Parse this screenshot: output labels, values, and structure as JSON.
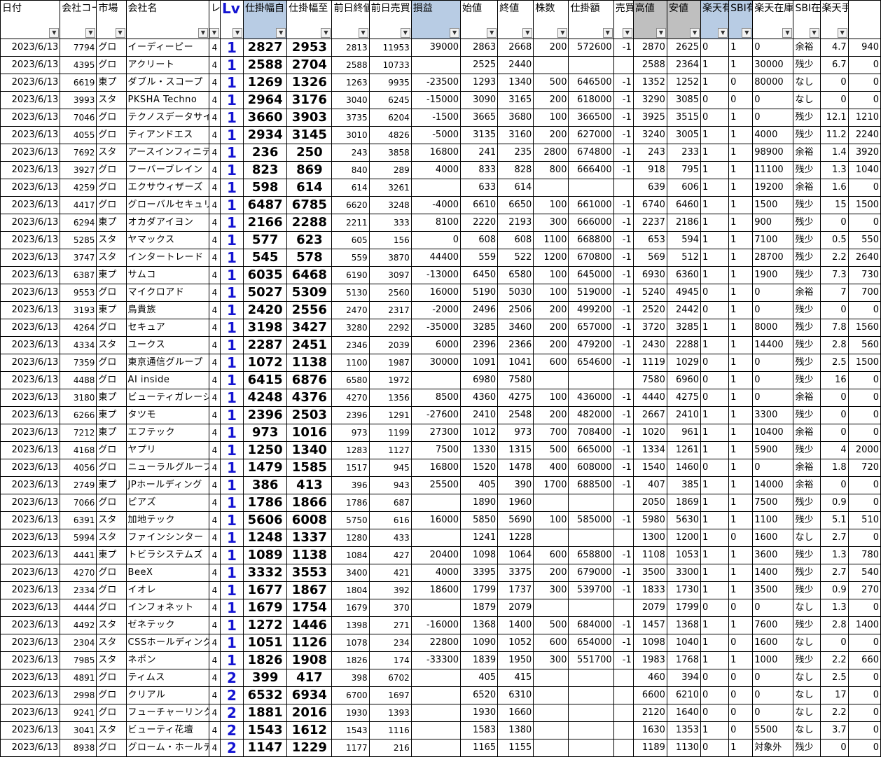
{
  "headers": [
    {
      "label": "日付",
      "style": ""
    },
    {
      "label": "会社コード",
      "style": ""
    },
    {
      "label": "市場",
      "style": ""
    },
    {
      "label": "会社名",
      "style": ""
    },
    {
      "label": "レ",
      "style": ""
    },
    {
      "label": "Lv",
      "style": "lv"
    },
    {
      "label": "仕掛幅自",
      "style": "blue"
    },
    {
      "label": "仕掛幅至",
      "style": ""
    },
    {
      "label": "前日終値",
      "style": ""
    },
    {
      "label": "前日売買(百万円)",
      "style": ""
    },
    {
      "label": "損益",
      "style": "blue"
    },
    {
      "label": "始値",
      "style": ""
    },
    {
      "label": "終値",
      "style": ""
    },
    {
      "label": "株数",
      "style": ""
    },
    {
      "label": "仕掛額",
      "style": ""
    },
    {
      "label": "売買",
      "style": ""
    },
    {
      "label": "高値",
      "style": "gray"
    },
    {
      "label": "安値",
      "style": "gray"
    },
    {
      "label": "楽天有無",
      "style": "blue"
    },
    {
      "label": "SBI有無",
      "style": "blue"
    },
    {
      "label": "楽天在庫数",
      "style": ""
    },
    {
      "label": "SBI在庫数",
      "style": ""
    },
    {
      "label": "楽天手数料",
      "style": ""
    },
    {
      "label": "",
      "style": ""
    }
  ],
  "rows": [
    [
      "2023/6/13",
      "7794",
      "グロ",
      "イーディーピー",
      "4",
      "1",
      "2827",
      "2953",
      "2813",
      "11953",
      "39000",
      "2863",
      "2668",
      "200",
      "572600",
      "-1",
      "2870",
      "2625",
      "0",
      "1",
      "0",
      "余裕",
      "4.7",
      "940"
    ],
    [
      "2023/6/13",
      "4395",
      "グロ",
      "アクリート",
      "4",
      "1",
      "2588",
      "2704",
      "2588",
      "10733",
      "",
      "2525",
      "2440",
      "",
      "",
      "",
      "2588",
      "2364",
      "1",
      "1",
      "30000",
      "残少",
      "6.7",
      "0"
    ],
    [
      "2023/6/13",
      "6619",
      "東プ",
      "ダブル・スコープ",
      "4",
      "1",
      "1269",
      "1326",
      "1263",
      "9935",
      "-23500",
      "1293",
      "1340",
      "500",
      "646500",
      "-1",
      "1352",
      "1252",
      "1",
      "0",
      "80000",
      "なし",
      "0",
      "0"
    ],
    [
      "2023/6/13",
      "3993",
      "スタ",
      "PKSHA Techno",
      "4",
      "1",
      "2964",
      "3176",
      "3040",
      "6245",
      "-15000",
      "3090",
      "3165",
      "200",
      "618000",
      "-1",
      "3290",
      "3085",
      "0",
      "0",
      "0",
      "なし",
      "0",
      "0"
    ],
    [
      "2023/6/13",
      "7046",
      "グロ",
      "テクノスデータサイ",
      "4",
      "1",
      "3660",
      "3903",
      "3735",
      "6204",
      "-1500",
      "3665",
      "3680",
      "100",
      "366500",
      "-1",
      "3925",
      "3515",
      "0",
      "1",
      "0",
      "残少",
      "12.1",
      "1210"
    ],
    [
      "2023/6/13",
      "4055",
      "グロ",
      "ティアンドエス",
      "4",
      "1",
      "2934",
      "3145",
      "3010",
      "4826",
      "-5000",
      "3135",
      "3160",
      "200",
      "627000",
      "-1",
      "3240",
      "3005",
      "1",
      "1",
      "4000",
      "残少",
      "11.2",
      "2240"
    ],
    [
      "2023/6/13",
      "7692",
      "スタ",
      "アースインフィニテ",
      "4",
      "1",
      "236",
      "250",
      "243",
      "3858",
      "16800",
      "241",
      "235",
      "2800",
      "674800",
      "-1",
      "243",
      "233",
      "1",
      "1",
      "98900",
      "余裕",
      "1.4",
      "3920"
    ],
    [
      "2023/6/13",
      "3927",
      "グロ",
      "フーバーブレイン",
      "4",
      "1",
      "823",
      "869",
      "840",
      "289",
      "4000",
      "833",
      "828",
      "800",
      "666400",
      "-1",
      "918",
      "795",
      "1",
      "1",
      "11100",
      "残少",
      "1.3",
      "1040"
    ],
    [
      "2023/6/13",
      "4259",
      "グロ",
      "エクサウィザーズ",
      "4",
      "1",
      "598",
      "614",
      "614",
      "3261",
      "",
      "633",
      "614",
      "",
      "",
      "",
      "639",
      "606",
      "1",
      "1",
      "19200",
      "余裕",
      "1.6",
      "0"
    ],
    [
      "2023/6/13",
      "4417",
      "グロ",
      "グローバルセキュリ",
      "4",
      "1",
      "6487",
      "6785",
      "6620",
      "3248",
      "-4000",
      "6610",
      "6650",
      "100",
      "661000",
      "-1",
      "6740",
      "6460",
      "1",
      "1",
      "1500",
      "残少",
      "15",
      "1500"
    ],
    [
      "2023/6/13",
      "6294",
      "東プ",
      "オカダアイヨン",
      "4",
      "1",
      "2166",
      "2288",
      "2211",
      "333",
      "8100",
      "2220",
      "2193",
      "300",
      "666000",
      "-1",
      "2237",
      "2186",
      "1",
      "1",
      "900",
      "残少",
      "0",
      "0"
    ],
    [
      "2023/6/13",
      "5285",
      "スタ",
      "ヤマックス",
      "4",
      "1",
      "577",
      "623",
      "605",
      "156",
      "0",
      "608",
      "608",
      "1100",
      "668800",
      "-1",
      "653",
      "594",
      "1",
      "1",
      "7100",
      "残少",
      "0.5",
      "550"
    ],
    [
      "2023/6/13",
      "3747",
      "スタ",
      "インタートレード",
      "4",
      "1",
      "545",
      "578",
      "559",
      "3870",
      "44400",
      "559",
      "522",
      "1200",
      "670800",
      "-1",
      "569",
      "512",
      "1",
      "1",
      "28700",
      "残少",
      "2.2",
      "2640"
    ],
    [
      "2023/6/13",
      "6387",
      "東プ",
      "サムコ",
      "4",
      "1",
      "6035",
      "6468",
      "6190",
      "3097",
      "-13000",
      "6450",
      "6580",
      "100",
      "645000",
      "-1",
      "6930",
      "6360",
      "1",
      "1",
      "1900",
      "残少",
      "7.3",
      "730"
    ],
    [
      "2023/6/13",
      "9553",
      "グロ",
      "マイクロアド",
      "4",
      "1",
      "5027",
      "5309",
      "5130",
      "2560",
      "16000",
      "5190",
      "5030",
      "100",
      "519000",
      "-1",
      "5240",
      "4945",
      "0",
      "1",
      "0",
      "余裕",
      "7",
      "700"
    ],
    [
      "2023/6/13",
      "3193",
      "東プ",
      "鳥貴族",
      "4",
      "1",
      "2420",
      "2556",
      "2470",
      "2317",
      "-2000",
      "2496",
      "2506",
      "200",
      "499200",
      "-1",
      "2520",
      "2442",
      "0",
      "1",
      "0",
      "残少",
      "0",
      "0"
    ],
    [
      "2023/6/13",
      "4264",
      "グロ",
      "セキュア",
      "4",
      "1",
      "3198",
      "3427",
      "3280",
      "2292",
      "-35000",
      "3285",
      "3460",
      "200",
      "657000",
      "-1",
      "3720",
      "3285",
      "1",
      "1",
      "8000",
      "残少",
      "7.8",
      "1560"
    ],
    [
      "2023/6/13",
      "4334",
      "スタ",
      "ユークス",
      "4",
      "1",
      "2287",
      "2451",
      "2346",
      "2039",
      "6000",
      "2396",
      "2366",
      "200",
      "479200",
      "-1",
      "2430",
      "2288",
      "1",
      "1",
      "14400",
      "残少",
      "2.8",
      "560"
    ],
    [
      "2023/6/13",
      "7359",
      "グロ",
      "東京通信グループ",
      "4",
      "1",
      "1072",
      "1138",
      "1100",
      "1987",
      "30000",
      "1091",
      "1041",
      "600",
      "654600",
      "-1",
      "1119",
      "1029",
      "0",
      "1",
      "0",
      "残少",
      "2.5",
      "1500"
    ],
    [
      "2023/6/13",
      "4488",
      "グロ",
      "AI inside",
      "4",
      "1",
      "6415",
      "6876",
      "6580",
      "1972",
      "",
      "6980",
      "7580",
      "",
      "",
      "",
      "7580",
      "6960",
      "0",
      "1",
      "0",
      "残少",
      "16",
      "0"
    ],
    [
      "2023/6/13",
      "3180",
      "東プ",
      "ビューティガレージ",
      "4",
      "1",
      "4248",
      "4376",
      "4270",
      "1356",
      "8500",
      "4360",
      "4275",
      "100",
      "436000",
      "-1",
      "4440",
      "4275",
      "0",
      "1",
      "0",
      "余裕",
      "0",
      "0"
    ],
    [
      "2023/6/13",
      "6266",
      "東プ",
      "タツモ",
      "4",
      "1",
      "2396",
      "2503",
      "2396",
      "1291",
      "-27600",
      "2410",
      "2548",
      "200",
      "482000",
      "-1",
      "2667",
      "2410",
      "1",
      "1",
      "3300",
      "残少",
      "0",
      "0"
    ],
    [
      "2023/6/13",
      "7212",
      "東プ",
      "エフテック",
      "4",
      "1",
      "973",
      "1016",
      "973",
      "1199",
      "27300",
      "1012",
      "973",
      "700",
      "708400",
      "-1",
      "1020",
      "961",
      "1",
      "1",
      "10400",
      "余裕",
      "0",
      "0"
    ],
    [
      "2023/6/13",
      "4168",
      "グロ",
      "ヤプリ",
      "4",
      "1",
      "1250",
      "1340",
      "1283",
      "1127",
      "7500",
      "1330",
      "1315",
      "500",
      "665000",
      "-1",
      "1334",
      "1261",
      "1",
      "1",
      "5900",
      "残少",
      "4",
      "2000"
    ],
    [
      "2023/6/13",
      "4056",
      "グロ",
      "ニューラルグループ",
      "4",
      "1",
      "1479",
      "1585",
      "1517",
      "945",
      "16800",
      "1520",
      "1478",
      "400",
      "608000",
      "-1",
      "1540",
      "1460",
      "0",
      "1",
      "0",
      "余裕",
      "1.8",
      "720"
    ],
    [
      "2023/6/13",
      "2749",
      "東プ",
      "JPホールディング",
      "4",
      "1",
      "386",
      "413",
      "396",
      "943",
      "25500",
      "405",
      "390",
      "1700",
      "688500",
      "-1",
      "407",
      "385",
      "1",
      "1",
      "14000",
      "余裕",
      "0",
      "0"
    ],
    [
      "2023/6/13",
      "7066",
      "グロ",
      "ピアズ",
      "4",
      "1",
      "1786",
      "1866",
      "1786",
      "687",
      "",
      "1890",
      "1960",
      "",
      "",
      "",
      "2050",
      "1869",
      "1",
      "1",
      "7500",
      "残少",
      "0.9",
      "0"
    ],
    [
      "2023/6/13",
      "6391",
      "スタ",
      "加地テック",
      "4",
      "1",
      "5606",
      "6008",
      "5750",
      "616",
      "16000",
      "5850",
      "5690",
      "100",
      "585000",
      "-1",
      "5980",
      "5630",
      "1",
      "1",
      "1100",
      "残少",
      "5.1",
      "510"
    ],
    [
      "2023/6/13",
      "5994",
      "スタ",
      "ファインシンター",
      "4",
      "1",
      "1248",
      "1337",
      "1280",
      "433",
      "",
      "1241",
      "1228",
      "",
      "",
      "",
      "1300",
      "1200",
      "1",
      "0",
      "1600",
      "なし",
      "2.7",
      "0"
    ],
    [
      "2023/6/13",
      "4441",
      "東プ",
      "トビラシステムズ",
      "4",
      "1",
      "1089",
      "1138",
      "1084",
      "427",
      "20400",
      "1098",
      "1064",
      "600",
      "658800",
      "-1",
      "1108",
      "1053",
      "1",
      "1",
      "3600",
      "残少",
      "1.3",
      "780"
    ],
    [
      "2023/6/13",
      "4270",
      "グロ",
      "BeeX",
      "4",
      "1",
      "3332",
      "3553",
      "3400",
      "421",
      "4000",
      "3395",
      "3375",
      "200",
      "679000",
      "-1",
      "3500",
      "3300",
      "1",
      "1",
      "1400",
      "残少",
      "2.7",
      "540"
    ],
    [
      "2023/6/13",
      "2334",
      "グロ",
      "イオレ",
      "4",
      "1",
      "1677",
      "1867",
      "1804",
      "392",
      "18600",
      "1799",
      "1737",
      "300",
      "539700",
      "-1",
      "1833",
      "1730",
      "1",
      "1",
      "3500",
      "残少",
      "0.9",
      "270"
    ],
    [
      "2023/6/13",
      "4444",
      "グロ",
      "インフォネット",
      "4",
      "1",
      "1679",
      "1754",
      "1679",
      "370",
      "",
      "1879",
      "2079",
      "",
      "",
      "",
      "2079",
      "1799",
      "0",
      "0",
      "0",
      "なし",
      "1.3",
      "0"
    ],
    [
      "2023/6/13",
      "4492",
      "スタ",
      "ゼネテック",
      "4",
      "1",
      "1272",
      "1446",
      "1398",
      "271",
      "-16000",
      "1368",
      "1400",
      "500",
      "684000",
      "-1",
      "1457",
      "1368",
      "1",
      "1",
      "7600",
      "残少",
      "2.8",
      "1400"
    ],
    [
      "2023/6/13",
      "2304",
      "スタ",
      "CSSホールディング",
      "4",
      "1",
      "1051",
      "1126",
      "1078",
      "234",
      "22800",
      "1090",
      "1052",
      "600",
      "654000",
      "-1",
      "1098",
      "1040",
      "1",
      "0",
      "1600",
      "なし",
      "0",
      "0"
    ],
    [
      "2023/6/13",
      "7985",
      "スタ",
      "ネポン",
      "4",
      "1",
      "1826",
      "1908",
      "1826",
      "174",
      "-33300",
      "1839",
      "1950",
      "300",
      "551700",
      "-1",
      "1983",
      "1768",
      "1",
      "1",
      "1000",
      "残少",
      "2.2",
      "660"
    ],
    [
      "2023/6/13",
      "4891",
      "グロ",
      "ティムス",
      "4",
      "2",
      "399",
      "417",
      "398",
      "6702",
      "",
      "405",
      "415",
      "",
      "",
      "",
      "460",
      "394",
      "0",
      "0",
      "0",
      "なし",
      "2.5",
      "0"
    ],
    [
      "2023/6/13",
      "2998",
      "グロ",
      "クリアル",
      "4",
      "2",
      "6532",
      "6934",
      "6700",
      "1697",
      "",
      "6520",
      "6310",
      "",
      "",
      "",
      "6600",
      "6210",
      "0",
      "0",
      "0",
      "なし",
      "17",
      "0"
    ],
    [
      "2023/6/13",
      "9241",
      "グロ",
      "フューチャーリンク",
      "4",
      "2",
      "1881",
      "2016",
      "1930",
      "1393",
      "",
      "1930",
      "1660",
      "",
      "",
      "",
      "2120",
      "1640",
      "0",
      "0",
      "0",
      "なし",
      "2.2",
      "0"
    ],
    [
      "2023/6/13",
      "3041",
      "スタ",
      "ビューティ花壇",
      "4",
      "2",
      "1543",
      "1612",
      "1543",
      "1116",
      "",
      "1583",
      "1380",
      "",
      "",
      "",
      "1630",
      "1353",
      "1",
      "0",
      "5500",
      "なし",
      "3.7",
      "0"
    ],
    [
      "2023/6/13",
      "8938",
      "グロ",
      "グローム・ホールデ",
      "4",
      "2",
      "1147",
      "1229",
      "1177",
      "216",
      "",
      "1165",
      "1155",
      "",
      "",
      "",
      "1189",
      "1130",
      "0",
      "1",
      "対象外",
      "残少",
      "0",
      "0"
    ]
  ]
}
